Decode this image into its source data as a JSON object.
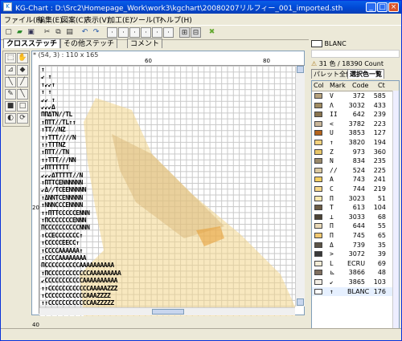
{
  "window": {
    "title": "KG-Chart : D:\\Src2\\Homepage_Work\\work3\\kgchart\\20080207リルフィー_001_imported.sth"
  },
  "menu": [
    "ファイル(F)",
    "編集(E)",
    "図案(C)",
    "表示(V)",
    "加工(E)",
    "ツール(T)",
    "ヘルプ(H)"
  ],
  "tabs": [
    "クロスステッチ",
    "その他ステッチ",
    "コメント"
  ],
  "canvas": {
    "coord_text": "* (54, 3)  : 110 x 165",
    "ruler_top_labels": [
      "60",
      "80"
    ],
    "ruler_left_labels": [
      "20",
      "40"
    ]
  },
  "palette": {
    "current_color": "BLANC",
    "summary": "31 色 / 18390 Count",
    "tabs": [
      "パレット全体",
      "選択色一覧"
    ],
    "columns": [
      "Col",
      "Mark",
      "Code",
      "Ct"
    ],
    "rows": [
      {
        "color": "#b7a37e",
        "mark": "V",
        "code": "372",
        "ct": "585"
      },
      {
        "color": "#a08c62",
        "mark": "Λ",
        "code": "3032",
        "ct": "433"
      },
      {
        "color": "#8a7550",
        "mark": "II",
        "code": "642",
        "ct": "239"
      },
      {
        "color": "#c9b79a",
        "mark": "<",
        "code": "3782",
        "ct": "223"
      },
      {
        "color": "#b5651d",
        "mark": "U",
        "code": "3853",
        "ct": "127"
      },
      {
        "color": "#f2d27e",
        "mark": "↑",
        "code": "3820",
        "ct": "194"
      },
      {
        "color": "#e8c76a",
        "mark": "Z",
        "code": "973",
        "ct": "360"
      },
      {
        "color": "#9a8a6a",
        "mark": "N",
        "code": "834",
        "ct": "235"
      },
      {
        "color": "#d9c8a0",
        "mark": "//",
        "code": "524",
        "ct": "225"
      },
      {
        "color": "#f5d062",
        "mark": "A",
        "code": "743",
        "ct": "241"
      },
      {
        "color": "#f7d98a",
        "mark": "C",
        "code": "744",
        "ct": "219"
      },
      {
        "color": "#fbe9b0",
        "mark": "П",
        "code": "3023",
        "ct": "51"
      },
      {
        "color": "#6d5d45",
        "mark": "T",
        "code": "613",
        "ct": "104"
      },
      {
        "color": "#4d4436",
        "mark": "⊥",
        "code": "3033",
        "ct": "68"
      },
      {
        "color": "#e8d9b8",
        "mark": "П",
        "code": "644",
        "ct": "55"
      },
      {
        "color": "#f0c870",
        "mark": "Π",
        "code": "745",
        "ct": "65"
      },
      {
        "color": "#5c5447",
        "mark": "Δ",
        "code": "739",
        "ct": "35"
      },
      {
        "color": "#3a3a3a",
        "mark": ">",
        "code": "3072",
        "ct": "39"
      },
      {
        "color": "#f3ecd6",
        "mark": "L",
        "code": "ECRU",
        "ct": "69"
      },
      {
        "color": "#807060",
        "mark": "⊾",
        "code": "3866",
        "ct": "48"
      },
      {
        "color": "#f4efe6",
        "mark": "↙",
        "code": "3865",
        "ct": "103"
      },
      {
        "color": "#ffffff",
        "mark": "↑",
        "code": "BLANC",
        "ct": "176"
      }
    ]
  },
  "pattern_rows": [
    "↑",
    "↙ ↑",
    "↑↙↙↑",
    "  ↑      ↑",
    "     ↙↙  ↑",
    "     ↙↙↙Δ",
    "    ПΠΔΤΝ//ΤL",
    "    ↑ПТТ//ΤL↑↑",
    "      ↑ТТ//ΝΖ",
    "    ↑↑ТТТ////Ν",
    "     ↑↑ΤТТΝΖ",
    "       ↑ПТТ//ΤΝ",
    "      ↑↑ΤТТ///ΝΝ",
    "       ↙ΠТТТΤΤΤ",
    "  ↙↙↙ΔΤТТΤΤ//Ν",
    "  ↑ΠТТСΕΝΝΝΝΝΝ",
    "   ↙Δ//ТСΕΕΝΝΝΝΝ",
    "     ↑ΔΝΝΤСΕΝΝΝΝΝ",
    "       ↑ΝΝΝСССΕΝΝΝΝ",
    "        ↑↑ΠТТСССССΕΝΝΝ",
    "          ↑ΠСССССССΕΝΝΝ",
    "            ΠССССССССССΝΝΝ",
    "             ↑ССЕССССССС↑",
    "               ↑СССССЕΕСС↑",
    "                 ↑ССССАААААА↑",
    "                ↑ССССАААААААА",
    "   ΠССССССССССАААААААААА",
    "  ↑ΠССССССССССССААААААААА",
    "  ↙СССССССССССАААААААAAA",
    "   ↑↑ССССССССССССАААААZZZ",
    "    ↑ССССССССССССАААZZZZ",
    "   ↑↑ССССССССССССААZZZZZ"
  ]
}
